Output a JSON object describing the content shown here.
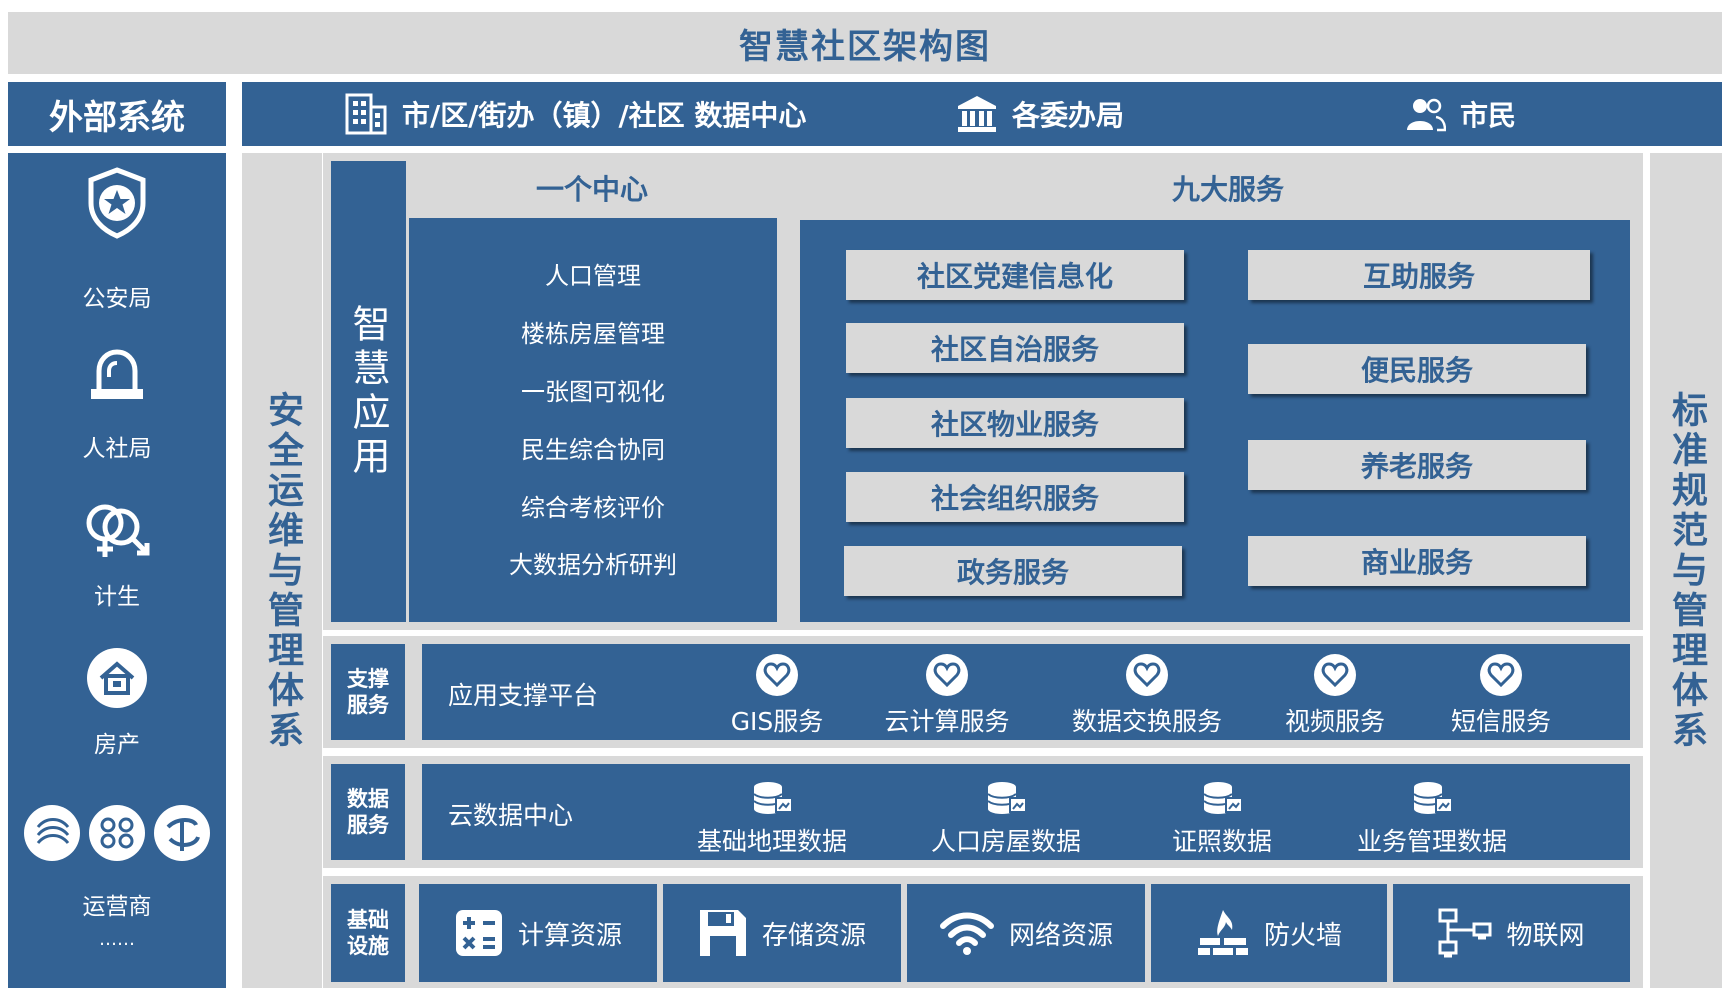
{
  "title": "智慧社区架构图",
  "external_system": {
    "header": "外部系统",
    "items": [
      {
        "label": "公安局",
        "icon": "police-badge-icon"
      },
      {
        "label": "人社局",
        "icon": "alarm-light-icon"
      },
      {
        "label": "计生",
        "icon": "gender-icon"
      },
      {
        "label": "房产",
        "icon": "house-icon"
      },
      {
        "label": "运营商",
        "icon": "carrier-logos-icon"
      }
    ],
    "more": "……"
  },
  "top_bar": {
    "data_center": "市/区/街办（镇）/社区 数据中心",
    "committees": "各委办局",
    "citizens": "市民"
  },
  "left_vertical": "安全运维与管理体系",
  "right_vertical": "标准规范与管理体系",
  "smart_app": {
    "label": "智慧应用",
    "center": {
      "title": "一个中心",
      "items": [
        "人口管理",
        "楼栋房屋管理",
        "一张图可视化",
        "民生综合协同",
        "综合考核评价",
        "大数据分析研判"
      ]
    },
    "services": {
      "title": "九大服务",
      "left": [
        "社区党建信息化",
        "社区自治服务",
        "社区物业服务",
        "社会组织服务",
        "政务服务"
      ],
      "right": [
        "互助服务",
        "便民服务",
        "养老服务",
        "商业服务"
      ]
    }
  },
  "support": {
    "label_line1": "支撑",
    "label_line2": "服务",
    "platform": "应用支撑平台",
    "items": [
      "GIS服务",
      "云计算服务",
      "数据交换服务",
      "视频服务",
      "短信服务"
    ]
  },
  "data": {
    "label_line1": "数据",
    "label_line2": "服务",
    "center": "云数据中心",
    "items": [
      "基础地理数据",
      "人口房屋数据",
      "证照数据",
      "业务管理数据"
    ]
  },
  "infra": {
    "label_line1": "基础",
    "label_line2": "设施",
    "items": [
      {
        "label": "计算资源",
        "icon": "calculator-icon"
      },
      {
        "label": "存储资源",
        "icon": "floppy-disk-icon"
      },
      {
        "label": "网络资源",
        "icon": "wifi-icon"
      },
      {
        "label": "防火墙",
        "icon": "firewall-icon"
      },
      {
        "label": "物联网",
        "icon": "iot-network-icon"
      }
    ]
  },
  "colors": {
    "primary": "#336294",
    "panel": "#d9d9d9",
    "text_light": "#ffffff"
  }
}
